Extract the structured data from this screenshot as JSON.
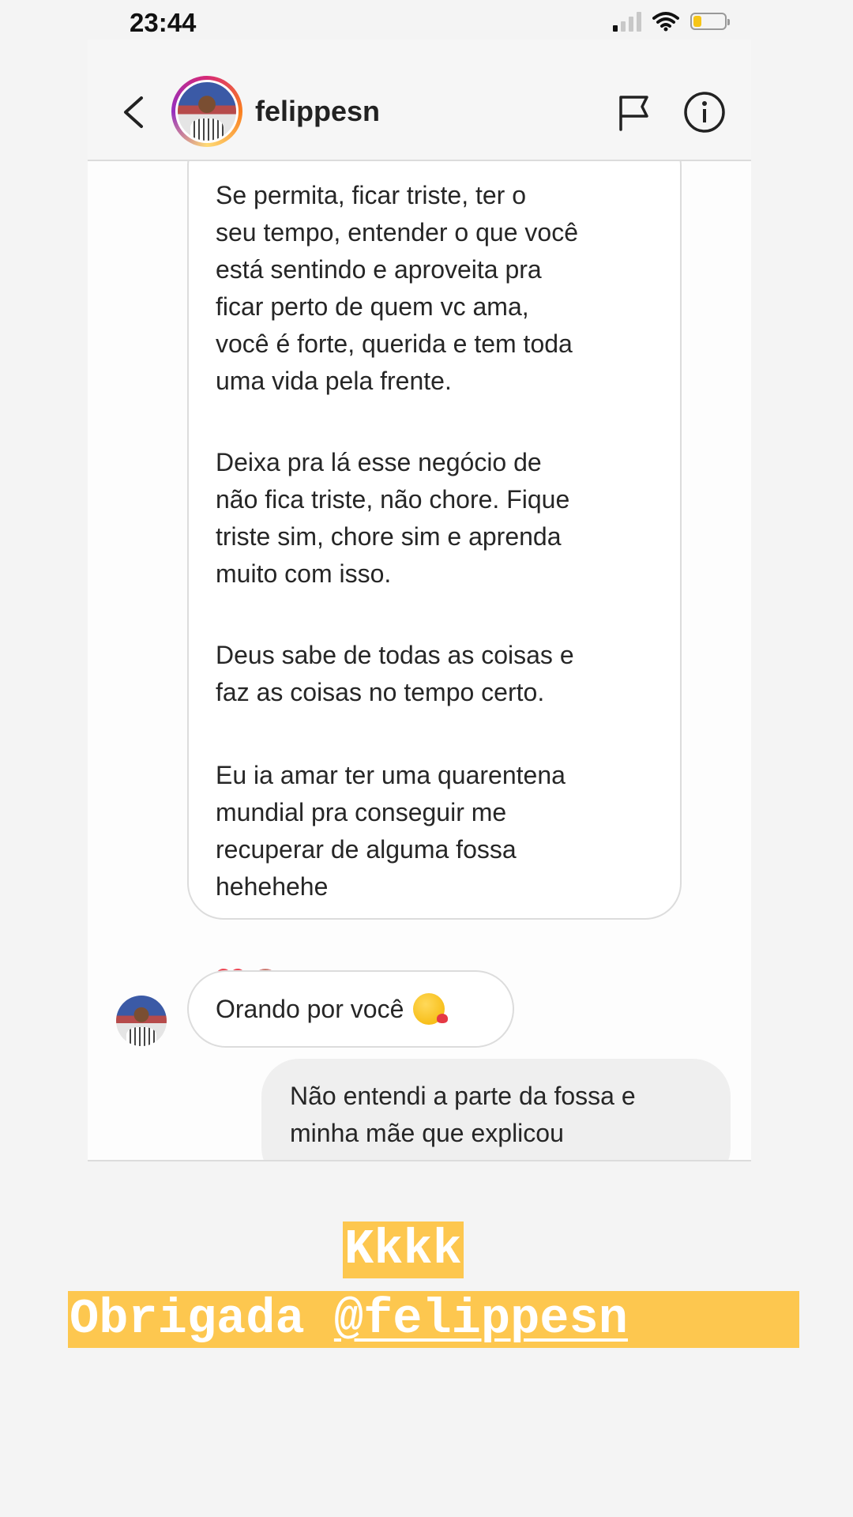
{
  "status_bar": {
    "time": "23:44"
  },
  "header": {
    "username": "felippesn",
    "icons": [
      "back-icon",
      "flag-icon",
      "info-icon"
    ]
  },
  "thread": {
    "long_message": {
      "paragraphs": [
        "Se permita, ficar triste, ter o\nseu tempo, entender o que você\nestá sentindo e aproveita pra\nficar perto de quem vc ama,\nvocê é forte, querida e tem toda\numa vida pela frente.",
        "Deixa pra lá esse negócio de\nnão fica triste, não chore. Fique\ntriste sim, chore sim e aprenda\nmuito com isso.",
        "Deus sabe de todas as coisas e\nfaz as coisas no tempo certo.",
        "Eu ia amar ter uma quarentena\nmundial pra conseguir me\nrecuperar de alguma fossa\nhehehehe"
      ],
      "reaction": "heart"
    },
    "short_message": {
      "text": "Orando por você",
      "emoji": "kiss-emoji"
    },
    "my_message": {
      "text": "Não entendi a parte da fossa e\nminha mãe que explicou"
    }
  },
  "story_text": {
    "line1": "Kkkk",
    "line2_prefix": "Obrigada ",
    "mention": "@felippesn",
    "highlight_color": "#fdc74f"
  },
  "colors": {
    "battery_level": "#f6c517",
    "heart": "#ed4956"
  }
}
